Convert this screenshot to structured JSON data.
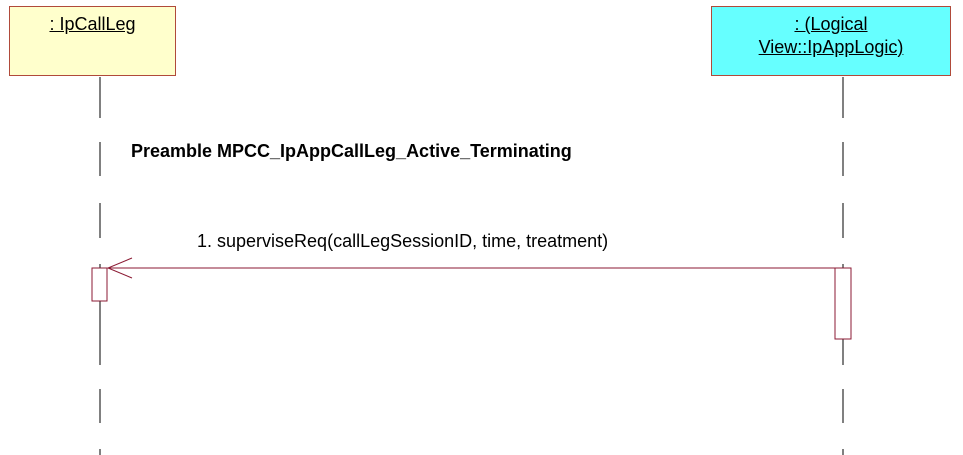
{
  "participants": [
    {
      "id": "ipcallleg",
      "label_line1": ": IpCallLeg",
      "label_line2": "",
      "fill": "#ffffcc"
    },
    {
      "id": "ipapplogic",
      "label_line1": ": (Logical",
      "label_line2": "View::IpAppLogic)",
      "fill": "#66ffff"
    }
  ],
  "note": {
    "text": "Preamble MPCC_IpAppCallLeg_Active_Terminating"
  },
  "messages": [
    {
      "label": "1. superviseReq(callLegSessionID, time, treatment)",
      "from": "ipapplogic",
      "to": "ipcallleg"
    }
  ],
  "colors": {
    "message_line": "#8b1a33",
    "box_border": "#b04a3a"
  }
}
